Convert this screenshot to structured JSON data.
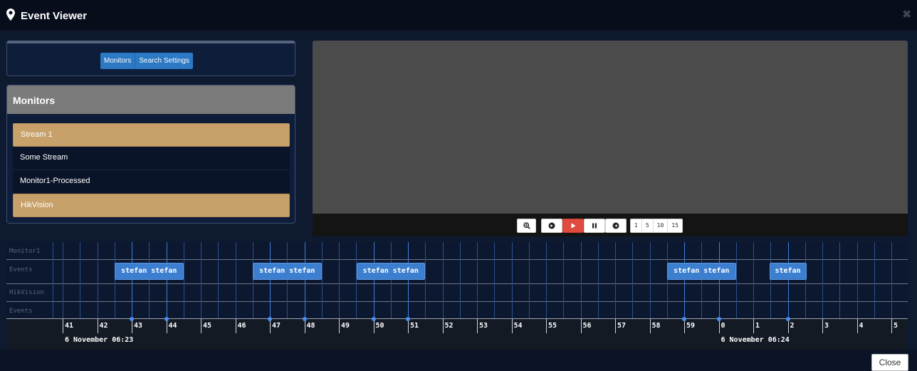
{
  "window": {
    "title": "Event Viewer",
    "close_glyph": "✖"
  },
  "tabs": [
    {
      "label": "Monitors"
    },
    {
      "label": "Search Settings"
    }
  ],
  "monitors_panel": {
    "heading": "Monitors",
    "items": [
      {
        "label": "Stream 1",
        "selected": true
      },
      {
        "label": "Some Stream",
        "selected": false
      },
      {
        "label": "Monitor1-Processed",
        "selected": false
      },
      {
        "label": "HikVision",
        "selected": true
      }
    ]
  },
  "playback": {
    "speeds": [
      "1",
      "5",
      "10",
      "15"
    ]
  },
  "timeline": {
    "rows": [
      {
        "monitor": "Monitor1",
        "events_label": "Events"
      },
      {
        "monitor": "HikVision",
        "events_label": "Events"
      }
    ],
    "tick_labels": [
      "41",
      "42",
      "43",
      "44",
      "45",
      "46",
      "47",
      "48",
      "49",
      "50",
      "51",
      "52",
      "53",
      "54",
      "55",
      "56",
      "57",
      "58",
      "59",
      "0",
      "1",
      "2",
      "3",
      "4",
      "5"
    ],
    "date_labels": [
      {
        "text": "6 November 06:23",
        "anchor_tick": "41"
      },
      {
        "text": "6 November 06:24",
        "anchor_tick": "0"
      }
    ],
    "events": [
      {
        "label": "stefan stefan",
        "start_tick": "43",
        "end_tick": "44"
      },
      {
        "label": "stefan stefan",
        "start_tick": "47",
        "end_tick": "48"
      },
      {
        "label": "stefan stefan",
        "start_tick": "50",
        "end_tick": "51"
      },
      {
        "label": "stefan stefan",
        "start_tick": "59",
        "end_tick": "0"
      },
      {
        "label": "stefan",
        "start_tick": "2",
        "end_tick": "2"
      }
    ]
  },
  "footer": {
    "close_label": "Close"
  },
  "colors": {
    "accent": "#2b78c4",
    "selected_item": "#c8a06a",
    "event_box": "#3c7fd0",
    "play_button": "#e04b3f"
  }
}
